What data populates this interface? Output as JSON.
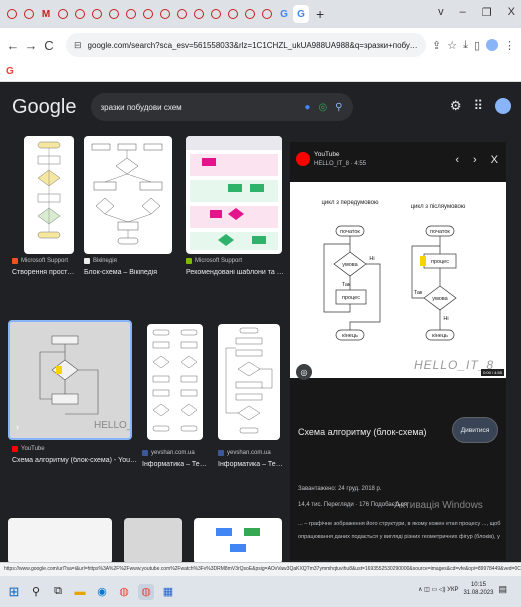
{
  "browser": {
    "tab_letters": [
      "M",
      "G"
    ],
    "new_tab": "+",
    "window_controls": [
      "v",
      "–",
      "❐",
      "X"
    ],
    "url": "google.com/search?sca_esv=561558033&rlz=1C1CHZL_ukUA988UA988&q=зразки+побудови+схем&tbm=isch&source=univ&fir=kfNLOxKQfs_Q1M%252C5O...",
    "nav": {
      "back": "←",
      "forward": "→",
      "reload": "C"
    },
    "bookmark_icon": "G"
  },
  "google": {
    "logo": "Google",
    "query": "зразки побудови схем",
    "colors": {
      "bg": "#202124",
      "panel": "#171717",
      "accent": "#8ab4f8"
    }
  },
  "results": [
    {
      "source": "Microsoft Support",
      "caption": "Створення простої бл..."
    },
    {
      "source": "Вікіпедія",
      "caption": "Блок-схема – Вікіпедія"
    },
    {
      "source": "Microsoft Support",
      "caption": "Рекомендовані шаблони та схеми V..."
    },
    {
      "source": "YouTube",
      "caption": "Схема алгоритму (блок-схема) - YouTube",
      "watermark": "HELLO_IT_8"
    },
    {
      "source": "yevshan.com.ua",
      "caption": "Інформатика – Теорія..."
    },
    {
      "source": "yevshan.com.ua",
      "caption": "Інформатика – Теорія..."
    }
  ],
  "panel": {
    "channel": "YouTube",
    "meta": "HELLO_IT_8 · 4:55",
    "controls": [
      "‹",
      "›",
      "X"
    ],
    "title": "Схема алгоритму (блок-схема)",
    "visit": "Дивитися",
    "date": "Завантажено: 24 груд. 2018 р.",
    "views": "14,4 тис. Перегляди · 176 Подобається",
    "desc": "... – графічне зображення його структури, в якому кожен етап процесу ..., щоб опрацювання даних подається у вигляді різних геометричних фігур (блоків), у",
    "watermark": "HELLO_IT_8",
    "timecode": "0:00 / 4:55",
    "diagram": {
      "left_title": "цикл з передумовою",
      "right_title": "цикл з післяумовою",
      "start": "початок",
      "condition": "умова",
      "yes": "Так",
      "no": "Ні",
      "process": "процес",
      "end": "кінець"
    }
  },
  "activate_windows": "Активація Windows",
  "status_url": "https://www.google.com/url?sa=i&url=https%3A%2F%2Fwww.youtube.com%2Fwatch%3Fv%3DRM8mV3rQsoE&psig=AOvVaw3QaKXQTm37ymmhqtuvihu8&ust=1693552530290000&source=images&cd=vfe&opi=89978449&ved=0CBAQjRxqFwoTCLC2...",
  "taskbar": {
    "tray": "∧  ◫  ▭  ◁)  УКР",
    "time": "10:15",
    "date": "31.08.2023"
  }
}
